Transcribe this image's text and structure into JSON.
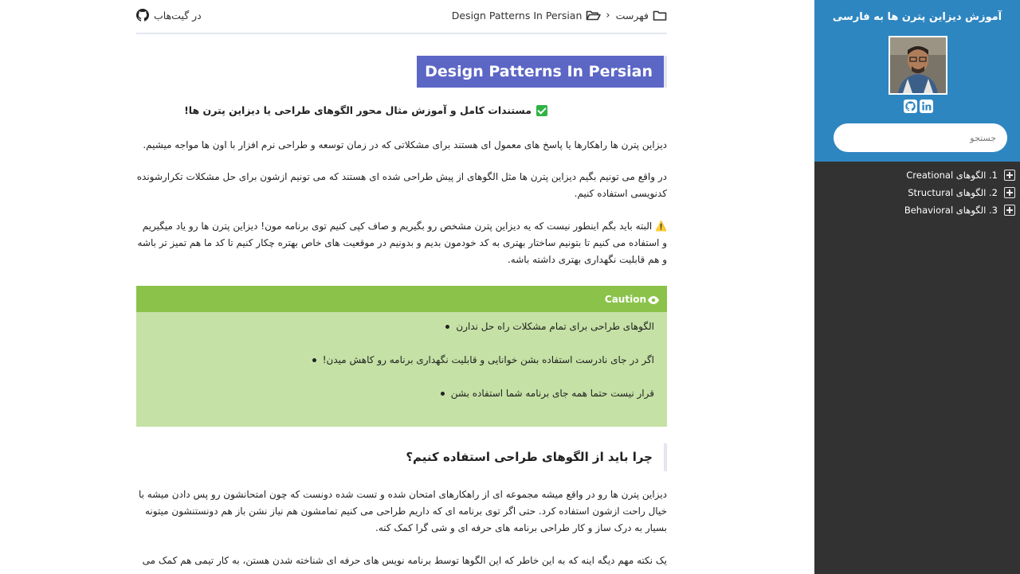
{
  "sidebar": {
    "title": "آموزش دیزاین پترن ها به فارسی",
    "search_placeholder": "جستجو",
    "toc": [
      {
        "label": "1. الگوهای Creational"
      },
      {
        "label": "2. الگوهای Structural"
      },
      {
        "label": "3. الگوهای Behavioral"
      }
    ],
    "colors": {
      "header": "#2e86c1",
      "body": "#323232"
    }
  },
  "topbar": {
    "crumb_root": "فهرست",
    "crumb_current": "Design Patterns In Persian",
    "github_label": "در گیت‌هاب"
  },
  "content": {
    "page_title": "Design Patterns In Persian",
    "lead": "مستندات کامل و آموزش مثال محور الگوهای طراحی یا دیزاین پترن ها!",
    "p1": "دیزاین پترن ها راهکارها یا پاسخ های معمول ای هستند برای مشکلاتی که در زمان توسعه و طراحی نرم افزار با اون ها مواجه میشیم.",
    "p2": "در واقع می تونیم بگیم دیزاین پترن ها مثل الگوهای از پیش طراحی شده ای هستند که می تونیم ازشون برای حل مشکلات تکرارشونده کدنویسی استفاده کنیم.",
    "p3": "⚠️ البته باید بگم اینطور نیست که یه دیزاین پترن مشخص رو بگیریم و صاف کپی کنیم توی برنامه مون! دیزاین پترن ها رو یاد میگیریم و استفاده می کنیم تا بتونیم ساختار بهتری به کد خودمون بدیم و بدونیم در موقعیت های خاص بهتره چکار کنیم تا کد ما هم تمیز تر باشه و هم قابلیت نگهداری بهتری داشته باشه.",
    "caution": {
      "title": "Caution",
      "items": [
        "الگوهای طراحی برای تمام مشکلات راه حل ندارن",
        "اگر در جای نادرست استفاده بشن خوانایی و قابلیت نگهداری برنامه رو کاهش میدن!",
        "قرار نیست حتما همه جای برنامه شما استفاده بشن"
      ],
      "colors": {
        "head": "#8bc34a",
        "body": "#c5e1a5"
      }
    },
    "h2": "چرا باید از الگوهای طراحی استفاده کنیم؟",
    "p4": "دیزاین پترن ها رو در واقع میشه مجموعه ای از راهکارهای امتحان شده و تست شده دونست که چون امتحانشون رو پس دادن میشه با خیال راحت ازشون استفاده کرد. حتی اگر توی برنامه ای که داریم طراحی می کنیم تمامشون هم نیاز نشن باز هم دونستنشون میتونه بسیار به درک ساز و کار طراحی برنامه های حرفه ای و شی گرا کمک کنه.",
    "p5": "یک نکته مهم دیگه اینه که به این خاطر که این الگوها توسط برنامه نویس های حرفه ای شناخته شدن هستن، به کار تیمی هم کمک می",
    "title_color": "#5b66c5"
  }
}
